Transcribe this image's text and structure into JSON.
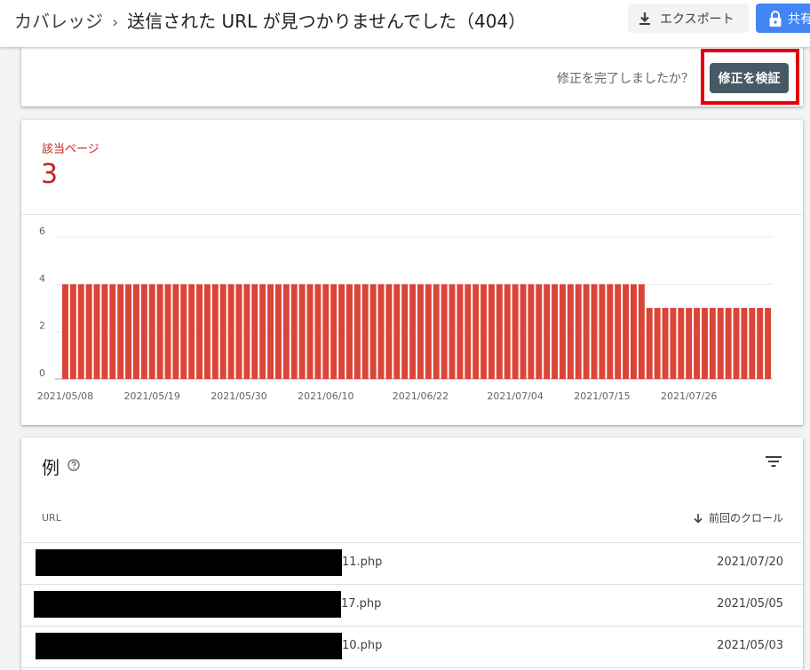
{
  "header": {
    "breadcrumb_root": "カバレッジ",
    "breadcrumb_sep": "›",
    "title": "送信された URL が見つかりませんでした（404）",
    "export_label": "エクスポート",
    "share_label": "共有"
  },
  "validate": {
    "question": "修正を完了しましたか？",
    "button_label": "修正を検証"
  },
  "summary": {
    "label": "該当ページ",
    "value": "3"
  },
  "colors": {
    "bar": "#db4437",
    "accent_red": "#c5221f",
    "validate_button": "#455a64",
    "share_button": "#4285f4",
    "highlight_border": "#e5000b"
  },
  "chart_data": {
    "type": "bar",
    "y_ticks": [
      0,
      2,
      4,
      6
    ],
    "ylim": [
      0,
      6
    ],
    "x_tick_labels": [
      "2021/05/08",
      "2021/05/19",
      "2021/05/30",
      "2021/06/10",
      "2021/06/22",
      "2021/07/04",
      "2021/07/15",
      "2021/07/26"
    ],
    "x_tick_indices": [
      0,
      11,
      22,
      33,
      45,
      57,
      68,
      79
    ],
    "values": [
      4,
      4,
      4,
      4,
      4,
      4,
      4,
      4,
      4,
      4,
      4,
      4,
      4,
      4,
      4,
      4,
      4,
      4,
      4,
      4,
      4,
      4,
      4,
      4,
      4,
      4,
      4,
      4,
      4,
      4,
      4,
      4,
      4,
      4,
      4,
      4,
      4,
      4,
      4,
      4,
      4,
      4,
      4,
      4,
      4,
      4,
      4,
      4,
      4,
      4,
      4,
      4,
      4,
      4,
      4,
      4,
      4,
      4,
      4,
      4,
      4,
      4,
      4,
      4,
      4,
      4,
      4,
      4,
      4,
      4,
      4,
      4,
      4,
      4,
      3,
      3,
      3,
      3,
      3,
      3,
      3,
      3,
      3,
      3,
      3,
      3,
      3,
      3,
      3,
      3
    ],
    "grid": true
  },
  "examples": {
    "title": "例",
    "help_icon": "help-circle-icon",
    "filter_icon": "filter-list-icon",
    "col_url": "URL",
    "col_crawl": "前回のクロール",
    "rows": [
      {
        "url_suffix": "11.php",
        "date": "2021/07/20"
      },
      {
        "url_suffix": "17.php",
        "date": "2021/05/05"
      },
      {
        "url_suffix": "10.php",
        "date": "2021/05/03"
      }
    ]
  }
}
